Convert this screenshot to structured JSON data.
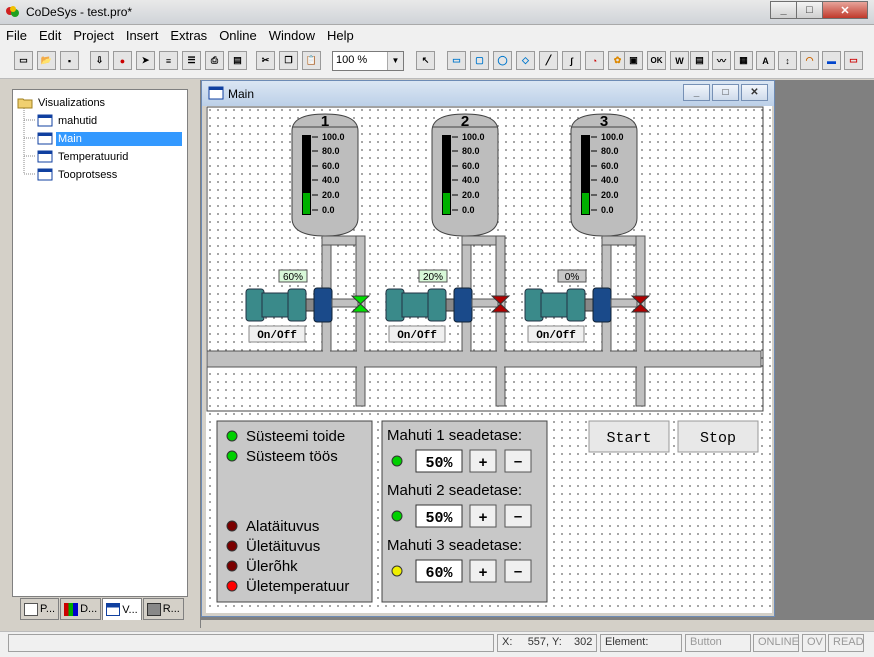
{
  "window": {
    "title": "CoDeSys - test.pro*"
  },
  "menu": [
    "File",
    "Edit",
    "Project",
    "Insert",
    "Extras",
    "Online",
    "Window",
    "Help"
  ],
  "toolbar": {
    "zoom": "100 %",
    "ok_label": "OK"
  },
  "tree": {
    "root": "Visualizations",
    "items": [
      {
        "label": "mahutid",
        "selected": false
      },
      {
        "label": "Main",
        "selected": true
      },
      {
        "label": "Temperatuurid",
        "selected": false
      },
      {
        "label": "Tooprotsess",
        "selected": false
      }
    ]
  },
  "bottom_tabs": [
    "P...",
    "D...",
    "V...",
    "R..."
  ],
  "main_window": {
    "title": "Main"
  },
  "tanks": [
    {
      "number": "1",
      "scale": [
        "100.0",
        "80.0",
        "60.0",
        "40.0",
        "20.0",
        "0.0"
      ],
      "level": 0.27,
      "pump_label": "60%",
      "pump_button": "On/Off",
      "valve_color": "#00e000"
    },
    {
      "number": "2",
      "scale": [
        "100.0",
        "80.0",
        "60.0",
        "40.0",
        "20.0",
        "0.0"
      ],
      "level": 0.27,
      "pump_label": "20%",
      "pump_button": "On/Off",
      "valve_color": "#b00000"
    },
    {
      "number": "3",
      "scale": [
        "100.0",
        "80.0",
        "60.0",
        "40.0",
        "20.0",
        "0.0"
      ],
      "level": 0.27,
      "pump_label": "0%",
      "pump_button": "On/Off",
      "valve_color": "#b00000"
    }
  ],
  "status_panel": {
    "ok_items": [
      {
        "label": "Süsteemi toide",
        "color": "#00d000"
      },
      {
        "label": "Süsteem töös",
        "color": "#00d000"
      }
    ],
    "alarms": [
      {
        "label": "Alatäituvus",
        "color": "#7a0000"
      },
      {
        "label": "Ületäituvus",
        "color": "#7a0000"
      },
      {
        "label": "Ülerõhk",
        "color": "#7a0000"
      },
      {
        "label": "Ületemperatuur",
        "color": "#ff0000"
      }
    ]
  },
  "setpoints": [
    {
      "label": "Mahuti 1 seadetase:",
      "value": "50%",
      "lamp": "#00d000"
    },
    {
      "label": "Mahuti 2 seadetase:",
      "value": "50%",
      "lamp": "#00d000"
    },
    {
      "label": "Mahuti 3 seadetase:",
      "value": "60%",
      "lamp": "#f0f000"
    }
  ],
  "buttons": {
    "plus": "+",
    "minus": "–",
    "start": "Start",
    "stop": "Stop"
  },
  "statusbar": {
    "x_label": "X:",
    "x_value": "557",
    "y_label": "Y:",
    "y_value": "302",
    "element_label": "Element:",
    "element_value": "Button",
    "online": "ONLINE",
    "ov": "OV",
    "read": "READ"
  }
}
